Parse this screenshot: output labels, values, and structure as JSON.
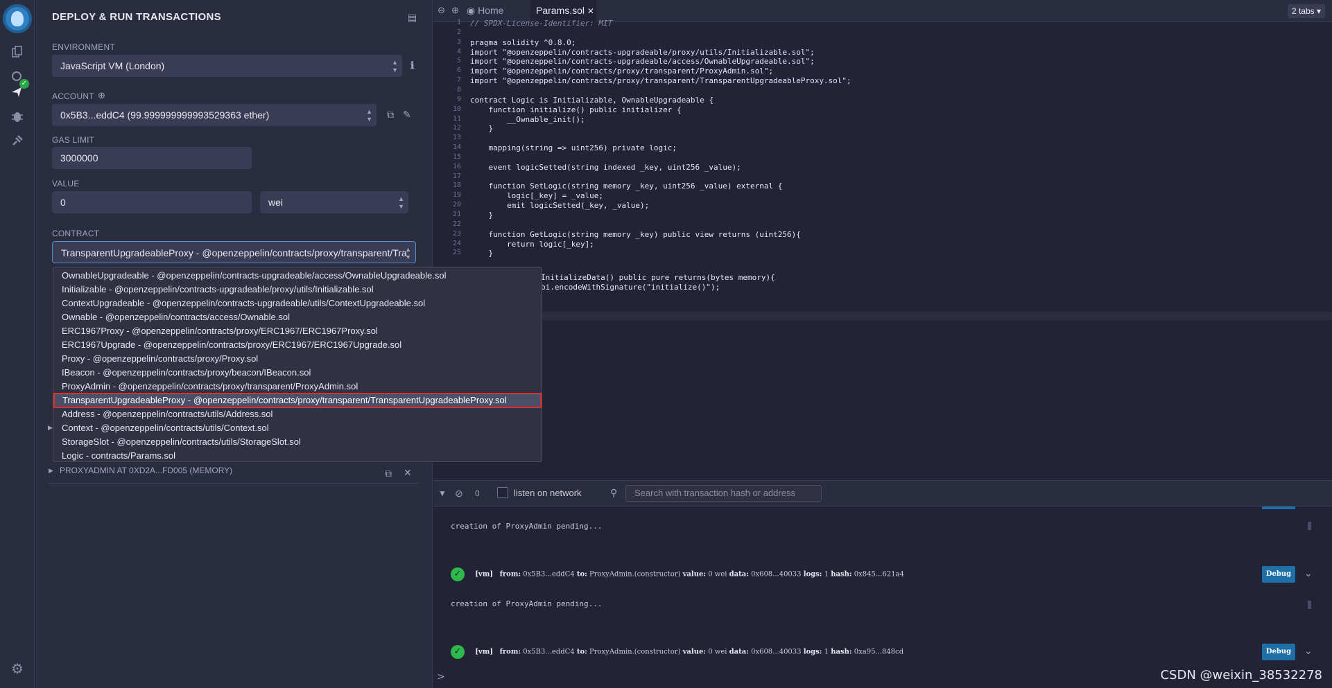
{
  "panel": {
    "title": "DEPLOY & RUN TRANSACTIONS",
    "environment_label": "ENVIRONMENT",
    "environment_value": "JavaScript VM (London)",
    "account_label": "ACCOUNT",
    "account_value": "0x5B3...eddC4 (99.999999999993529363 ether)",
    "gas_limit_label": "GAS LIMIT",
    "gas_limit_value": "3000000",
    "value_label": "VALUE",
    "value_amount": "0",
    "value_unit": "wei",
    "contract_label": "CONTRACT",
    "contract_value": "TransparentUpgradeableProxy - @openzeppelin/contracts/proxy/transparent/Tra",
    "deployed_instance": "PROXYADMIN AT 0XD2A...FD005 (MEMORY)"
  },
  "dropdown": {
    "items": [
      "OwnableUpgradeable - @openzeppelin/contracts-upgradeable/access/OwnableUpgradeable.sol",
      "Initializable - @openzeppelin/contracts-upgradeable/proxy/utils/Initializable.sol",
      "ContextUpgradeable - @openzeppelin/contracts-upgradeable/utils/ContextUpgradeable.sol",
      "Ownable - @openzeppelin/contracts/access/Ownable.sol",
      "ERC1967Proxy - @openzeppelin/contracts/proxy/ERC1967/ERC1967Proxy.sol",
      "ERC1967Upgrade - @openzeppelin/contracts/proxy/ERC1967/ERC1967Upgrade.sol",
      "Proxy - @openzeppelin/contracts/proxy/Proxy.sol",
      "IBeacon - @openzeppelin/contracts/proxy/beacon/IBeacon.sol",
      "ProxyAdmin - @openzeppelin/contracts/proxy/transparent/ProxyAdmin.sol",
      "TransparentUpgradeableProxy - @openzeppelin/contracts/proxy/transparent/TransparentUpgradeableProxy.sol",
      "Address - @openzeppelin/contracts/utils/Address.sol",
      "Context - @openzeppelin/contracts/utils/Context.sol",
      "StorageSlot - @openzeppelin/contracts/utils/StorageSlot.sol",
      "Logic - contracts/Params.sol"
    ],
    "highlighted_index": 9
  },
  "tabs": {
    "home": "Home",
    "active": "Params.sol",
    "count": "2 tabs"
  },
  "editor": {
    "lines": [
      {
        "n": "1",
        "t": "// SPDX-License-Identifier: MIT"
      },
      {
        "n": "2",
        "t": ""
      },
      {
        "n": "3",
        "t": "pragma solidity ^0.8.0;"
      },
      {
        "n": "4",
        "t": "import \"@openzeppelin/contracts-upgradeable/proxy/utils/Initializable.sol\";"
      },
      {
        "n": "5",
        "t": "import \"@openzeppelin/contracts-upgradeable/access/OwnableUpgradeable.sol\";"
      },
      {
        "n": "6",
        "t": "import \"@openzeppelin/contracts/proxy/transparent/ProxyAdmin.sol\";"
      },
      {
        "n": "7",
        "t": "import \"@openzeppelin/contracts/proxy/transparent/TransparentUpgradeableProxy.sol\";"
      },
      {
        "n": "8",
        "t": ""
      },
      {
        "n": "9",
        "t": "contract Logic is Initializable, OwnableUpgradeable {"
      },
      {
        "n": "10",
        "t": "    function initialize() public initializer {"
      },
      {
        "n": "11",
        "t": "        __Ownable_init();"
      },
      {
        "n": "12",
        "t": "    }"
      },
      {
        "n": "13",
        "t": ""
      },
      {
        "n": "14",
        "t": "    mapping(string => uint256) private logic;"
      },
      {
        "n": "15",
        "t": ""
      },
      {
        "n": "16",
        "t": "    event logicSetted(string indexed _key, uint256 _value);"
      },
      {
        "n": "17",
        "t": ""
      },
      {
        "n": "18",
        "t": "    function SetLogic(string memory _key, uint256 _value) external {"
      },
      {
        "n": "19",
        "t": "        logic[_key] = _value;"
      },
      {
        "n": "20",
        "t": "        emit logicSetted(_key, _value);"
      },
      {
        "n": "21",
        "t": "    }"
      },
      {
        "n": "22",
        "t": ""
      },
      {
        "n": "23",
        "t": "    function GetLogic(string memory _key) public view returns (uint256){"
      },
      {
        "n": "24",
        "t": "        return logic[_key];"
      },
      {
        "n": "25",
        "t": "    }"
      }
    ],
    "hidden_line_a": "InitializeData() public pure returns(bytes memory){",
    "hidden_line_b": "bi.encodeWithSignature(\"initialize()\");"
  },
  "terminal": {
    "pending_count": "0",
    "listen_label": "listen on network",
    "search_placeholder": "Search with transaction hash or address",
    "pending_1": "creation of ProxyAdmin pending...",
    "pending_2": "creation of ProxyAdmin pending...",
    "tx1": {
      "vm": "[vm]",
      "from_label": "from:",
      "from": "0x5B3...eddC4",
      "to_label": "to:",
      "to": "ProxyAdmin.(constructor)",
      "value_label": "value:",
      "value": "0 wei",
      "data_label": "data:",
      "data": "0x608...40033",
      "logs_label": "logs:",
      "logs": "1",
      "hash_label": "hash:",
      "hash": "0x845...621a4"
    },
    "tx2": {
      "vm": "[vm]",
      "from_label": "from:",
      "from": "0x5B3...eddC4",
      "to_label": "to:",
      "to": "ProxyAdmin.(constructor)",
      "value_label": "value:",
      "value": "0 wei",
      "data_label": "data:",
      "data": "0x608...40033",
      "logs_label": "logs:",
      "logs": "1",
      "hash_label": "hash:",
      "hash": "0xa95...848cd"
    },
    "debug_label": "Debug",
    "prompt": ">"
  },
  "watermark": "CSDN @weixin_38532278"
}
